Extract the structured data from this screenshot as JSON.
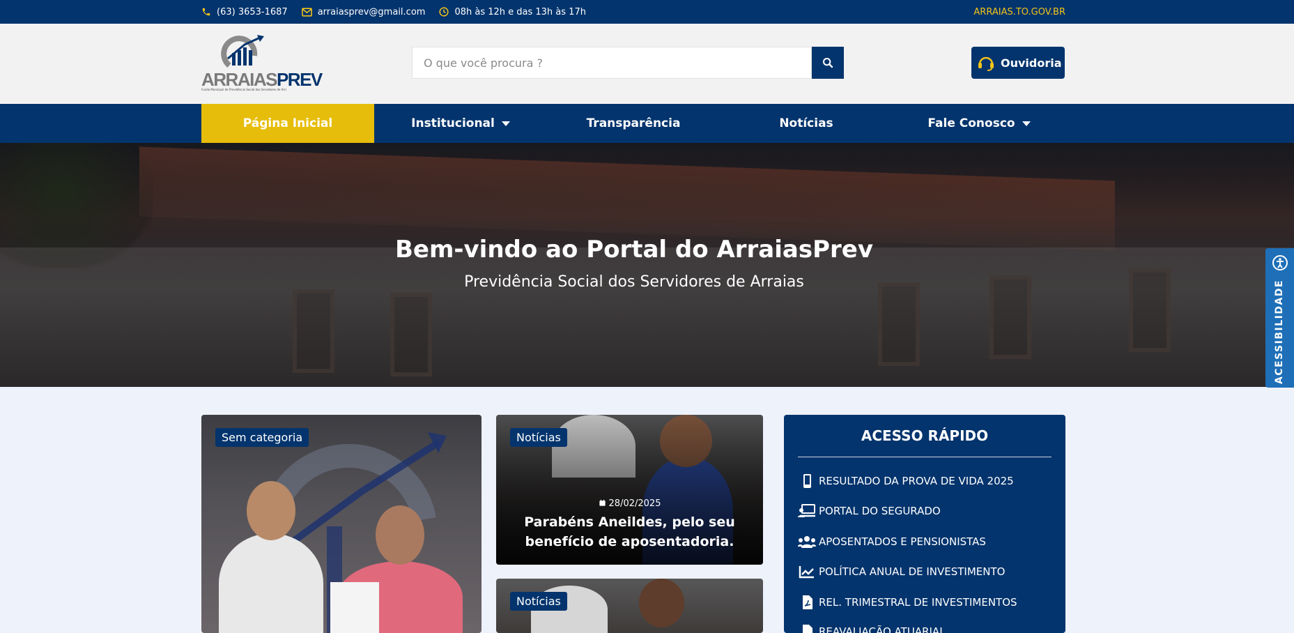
{
  "topbar": {
    "phone": "(63) 3653-1687",
    "email": "arraiasprev@gmail.com",
    "hours": "08h às 12h e das 13h às 17h",
    "site": "ARRAIAS.TO.GOV.BR"
  },
  "header": {
    "logo_text_a": "ARRAIAS",
    "logo_text_b": "PREV",
    "logo_sub": "Fundo Municipal de Previdência Social dos Servidores de Arraias/TO",
    "search_placeholder": "O que você procura ?",
    "ouvidoria": "Ouvidoria"
  },
  "nav": {
    "items": [
      {
        "label": "Página Inicial"
      },
      {
        "label": "Institucional"
      },
      {
        "label": "Transparência"
      },
      {
        "label": "Notícias"
      },
      {
        "label": "Fale Conosco"
      }
    ]
  },
  "hero": {
    "title": "Bem-vindo ao Portal do ArraiasPrev",
    "subtitle": "Previdência Social dos Servidores de Arraias"
  },
  "accessibility": {
    "label": "ACESSIBILIDADE"
  },
  "cards": [
    {
      "category": "Sem categoria"
    },
    {
      "category": "Notícias",
      "date": "28/02/2025",
      "title": "Parabéns Aneildes, pelo seu benefício de aposentadoria."
    },
    {
      "category": "Notícias"
    }
  ],
  "quick_access": {
    "title": "ACESSO RÁPIDO",
    "items": [
      {
        "label": "RESULTADO DA PROVA DE VIDA 2025",
        "icon": "mobile-icon"
      },
      {
        "label": "PORTAL DO SEGURADO",
        "icon": "laptop-user-icon"
      },
      {
        "label": "APOSENTADOS E PENSIONISTAS",
        "icon": "users-icon"
      },
      {
        "label": "POLÍTICA ANUAL DE INVESTIMENTO",
        "icon": "chart-line-icon"
      },
      {
        "label": "REL. TRIMESTRAL DE INVESTIMENTOS",
        "icon": "file-pdf-icon"
      },
      {
        "label": "REAVALIAÇÃO ATUARIAL",
        "icon": "file-icon"
      }
    ]
  },
  "colors": {
    "primary": "#04346d",
    "accent": "#e6bd0a",
    "link": "#f2c418",
    "accessibility": "#1e6fb8"
  }
}
